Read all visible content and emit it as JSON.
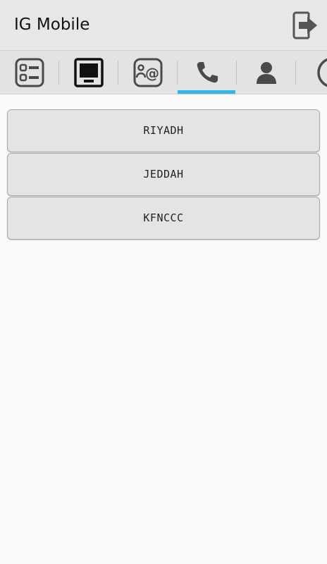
{
  "app_bar": {
    "title": "IG Mobile",
    "logout_icon": "logout-arrow-icon"
  },
  "tabs": [
    {
      "icon": "checklist-icon"
    },
    {
      "icon": "monitor-icon"
    },
    {
      "icon": "contact-email-icon"
    },
    {
      "icon": "phone-icon",
      "selected": true
    },
    {
      "icon": "person-icon"
    },
    {
      "icon": "info-icon"
    }
  ],
  "accent_color": "#33b5e5",
  "locations": [
    {
      "label": "RIYADH"
    },
    {
      "label": "JEDDAH"
    },
    {
      "label": "KFNCCC"
    }
  ]
}
